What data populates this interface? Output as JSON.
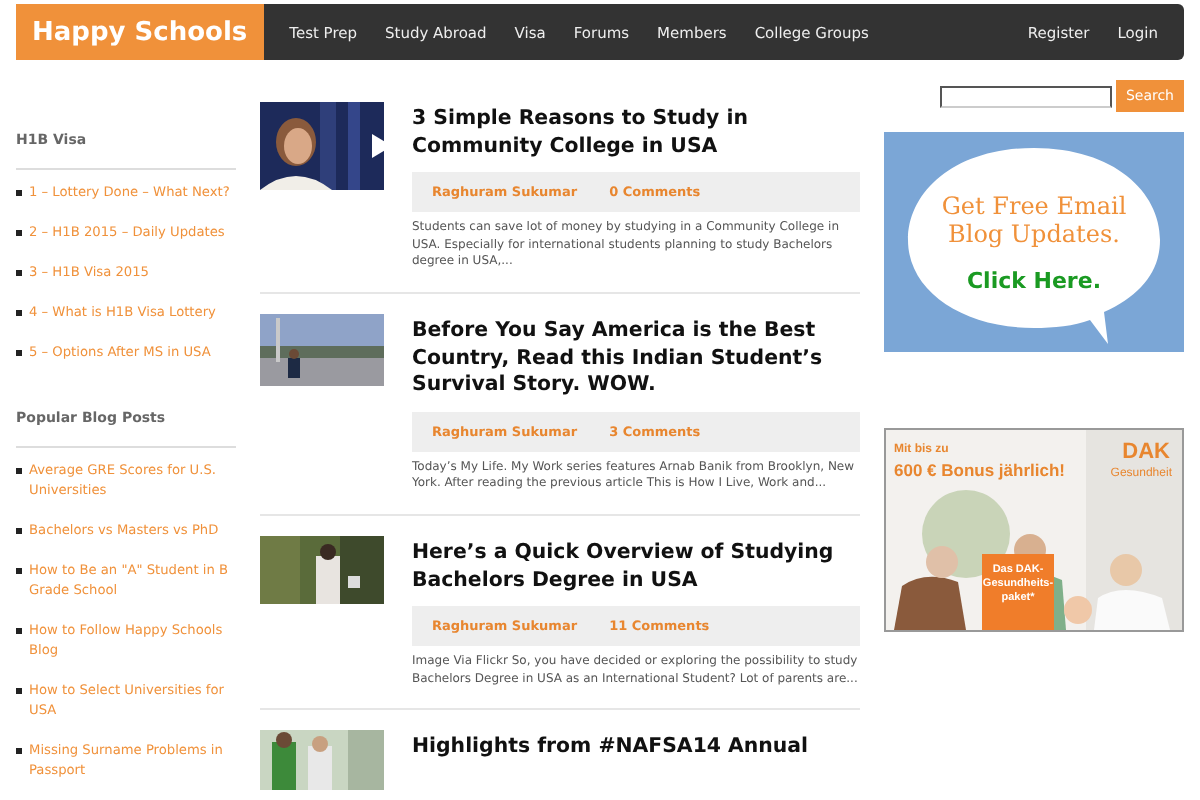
{
  "header": {
    "logo": "Happy Schools",
    "nav": [
      {
        "label": "Test Prep"
      },
      {
        "label": "Study Abroad"
      },
      {
        "label": "Visa"
      },
      {
        "label": "Forums"
      },
      {
        "label": "Members"
      },
      {
        "label": "College Groups"
      }
    ],
    "account": [
      {
        "label": "Register"
      },
      {
        "label": "Login"
      }
    ]
  },
  "left_sidebar": {
    "widgets": [
      {
        "title": "H1B Visa",
        "links": [
          "1 – Lottery Done – What Next?",
          "2 – H1B 2015 – Daily Updates",
          "3 – H1B Visa 2015",
          "4 – What is H1B Visa Lottery",
          "5 – Options After MS in USA"
        ]
      },
      {
        "title": "Popular Blog Posts",
        "links": [
          "Average GRE Scores for U.S. Universities",
          "Bachelors vs Masters vs PhD",
          "How to Be an \"A\" Student in B Grade School",
          "How to Follow Happy Schools Blog",
          "How to Select Universities for USA",
          "Missing Surname Problems in Passport"
        ]
      }
    ]
  },
  "posts": [
    {
      "title": "3 Simple Reasons to Study in Community College in USA",
      "video": true,
      "author": "Raghuram Sukumar",
      "comments": "0 Comments",
      "excerpt": "Students can save lot of money by studying in a Community College in USA. Especially for international students planning to study Bachelors degree in USA,..."
    },
    {
      "title": "Before You Say America is the Best Country, Read this Indian Student’s Survival Story. WOW.",
      "video": false,
      "author": "Raghuram Sukumar",
      "comments": "3 Comments",
      "excerpt": "Today’s My Life. My Work series features Arnab Banik from Brooklyn, New York. After reading the previous article This is How I Live, Work and..."
    },
    {
      "title": "Here’s a Quick Overview of Studying Bachelors Degree in USA",
      "video": false,
      "author": "Raghuram Sukumar",
      "comments": "11 Comments",
      "excerpt": "Image Via Flickr So, you have decided or exploring the possibility to study Bachelors Degree in USA as an International Student? Lot of parents are..."
    },
    {
      "title": "Highlights from #NAFSA14 Annual",
      "video": false
    }
  ],
  "right_sidebar": {
    "search_button": "Search",
    "email_ad": {
      "headline": "Get Free Email Blog Updates.",
      "action": "Click Here."
    },
    "dak_ad": {
      "kicker": "Mit bis zu",
      "headline": "600 € Bonus jährlich!",
      "brand": "DAK",
      "brand_sub": "Gesundheit",
      "package": "Das DAK-Gesundheits-paket*"
    }
  }
}
